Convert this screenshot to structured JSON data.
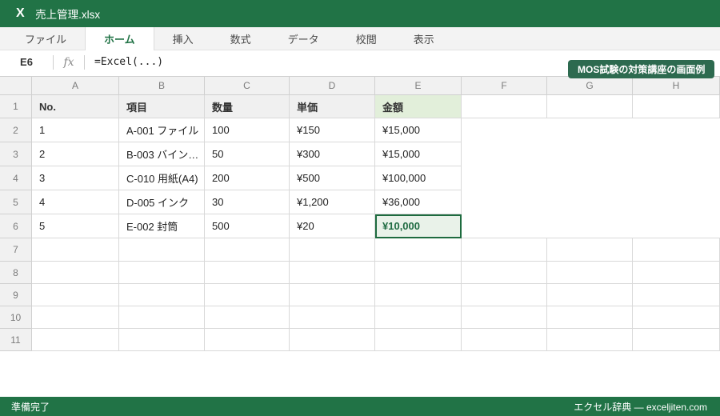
{
  "window": {
    "app_icon": "X",
    "title": "売上管理.xlsx"
  },
  "ribbon": {
    "tabs": [
      {
        "id": "file",
        "label": "ファイル",
        "active": false
      },
      {
        "id": "home",
        "label": "ホーム",
        "active": true
      },
      {
        "id": "insert",
        "label": "挿入",
        "active": false
      },
      {
        "id": "formulas",
        "label": "数式",
        "active": false
      },
      {
        "id": "data",
        "label": "データ",
        "active": false
      },
      {
        "id": "review",
        "label": "校閲",
        "active": false
      },
      {
        "id": "view",
        "label": "表示",
        "active": false
      }
    ]
  },
  "formula_bar": {
    "cell_reference": "E6",
    "fx_label": "fx",
    "formula": "=Excel(...)"
  },
  "badge": {
    "label": "MOS試験の対策講座の画面例"
  },
  "grid": {
    "column_headers": [
      "A",
      "B",
      "C",
      "D",
      "E",
      "F",
      "G",
      "H"
    ],
    "row_headers": [
      "1",
      "2",
      "3",
      "4",
      "5",
      "6",
      "7",
      "8",
      "9",
      "10",
      "11"
    ],
    "header_row": [
      "No.",
      "項目",
      "数量",
      "単価",
      "金額"
    ],
    "rows": [
      [
        "1",
        "A-001 ファイル",
        "100",
        "¥150",
        "¥15,000"
      ],
      [
        "2",
        "B-003 バイン…",
        "50",
        "¥300",
        "¥15,000"
      ],
      [
        "3",
        "C-010 用紙(A4)",
        "200",
        "¥500",
        "¥100,000"
      ],
      [
        "4",
        "D-005 インク",
        "30",
        "¥1,200",
        "¥36,000"
      ],
      [
        "5",
        "E-002 封筒",
        "500",
        "¥20",
        "¥10,000"
      ]
    ],
    "selected_cell": {
      "ref": "E6",
      "value": "¥10,000"
    }
  },
  "status_bar": {
    "left": "準備完了",
    "right": "エクセル辞典 — exceljiten.com"
  },
  "colors": {
    "brand_green": "#217346",
    "badge_green": "#2d6a4f",
    "selection_border": "#1e6b3f",
    "selection_fill": "#e9f2e9",
    "header_fill_green": "#e2efda",
    "header_fill_gray": "#f0f0f0"
  }
}
